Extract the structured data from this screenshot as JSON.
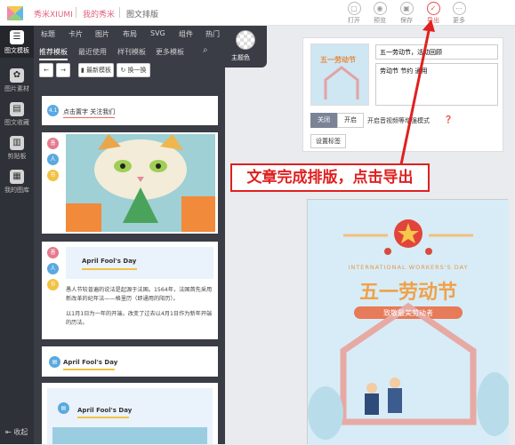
{
  "header": {
    "brand": "秀米XIUMI",
    "nav": [
      "我的秀米",
      "图文排版"
    ],
    "tools": [
      {
        "icon": "open-icon",
        "label": "打开"
      },
      {
        "icon": "preview-icon",
        "label": "预览"
      },
      {
        "icon": "save-icon",
        "label": "保存"
      },
      {
        "icon": "export-icon",
        "label": "导出"
      },
      {
        "icon": "more-icon",
        "label": "更多"
      }
    ]
  },
  "sidebar": {
    "items": [
      {
        "icon": "layout-icon",
        "label": "图文模板"
      },
      {
        "icon": "image-icon",
        "label": "图片素材"
      },
      {
        "icon": "bookmark-icon",
        "label": "图文收藏"
      },
      {
        "icon": "clipboard-icon",
        "label": "剪贴板"
      },
      {
        "icon": "gallery-icon",
        "label": "我的图库"
      }
    ],
    "collapse": "⇤ 收起"
  },
  "panel": {
    "tabs_top": [
      "标题",
      "卡片",
      "图片",
      "布局",
      "SVG",
      "组件",
      "热门"
    ],
    "tabs_sub": [
      "推荐模板",
      "最近使用",
      "样刊模板",
      "更多模板"
    ],
    "btn_latest": "最新模板",
    "btn_switch": "换一换",
    "theme_label": "主题色",
    "card1_title": "点击置字 关注我们",
    "card1_num": "4.1",
    "bubbles": [
      "愚",
      "人",
      "节"
    ],
    "card3_title": "April Fool's Day",
    "card3_text1": "愚人节较普遍的说法是起源于法国。1564年，法国首先采用新改革的纪年法——格里历（即通用的阳历）。",
    "card3_text2": "以1月1日为一年的开端，改变了过去以4月1日作为新年开端的历法。",
    "card4_title": "April Fool's Day",
    "card5_title": "April Fool's Day"
  },
  "right_panel": {
    "title_value": "五一劳动节，活动回顾",
    "desc_value": "劳动节 节约 通用",
    "btn_close": "关闭",
    "btn_open": "开启",
    "enhance_text": "开启音视频等增强模式",
    "btn_settings": "设置标签"
  },
  "preview": {
    "subtitle": "INTERNATIONAL WORKERS'S DAY",
    "title": "五一劳动节",
    "tag": "致敬最美劳动者",
    "thumb_title": "五一劳动节"
  },
  "callout": "文章完成排版，点击导出",
  "colors": {
    "brand": "#e2607f",
    "accent": "#e05050",
    "sidebar": "#2f3138"
  }
}
